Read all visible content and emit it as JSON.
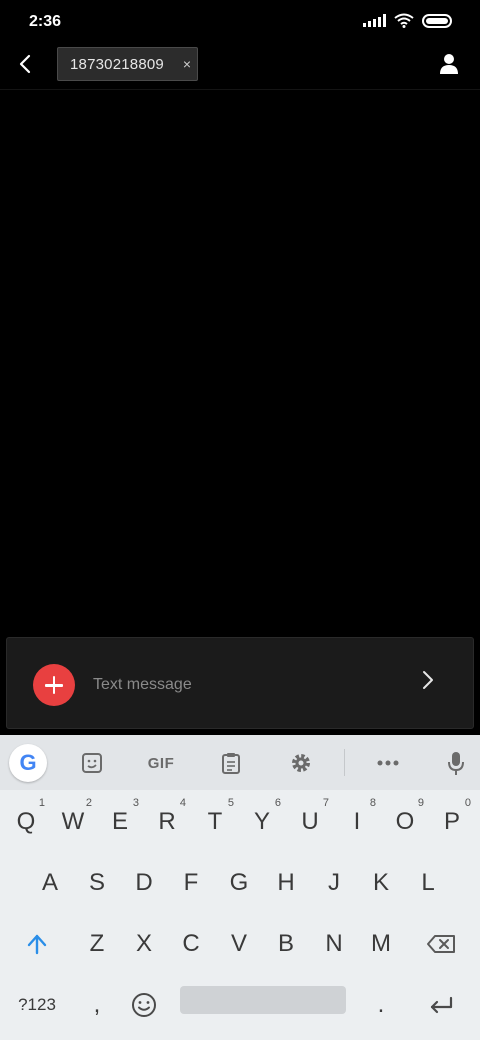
{
  "status_bar": {
    "time": "2:36",
    "icons": [
      "signal-icon",
      "wifi-icon",
      "battery-icon"
    ]
  },
  "top_bar": {
    "back_icon": "chevron-left-icon",
    "recipient": "18730218809",
    "chip_close": "×",
    "contact_icon": "person-icon"
  },
  "compose": {
    "attach_icon": "plus-icon",
    "placeholder": "Text message",
    "send_icon": "chevron-right-icon",
    "attach_color": "#e84040"
  },
  "keyboard": {
    "toolbar": {
      "google_label": "G",
      "sticker_icon": "sticker-icon",
      "gif_label": "GIF",
      "clipboard_icon": "clipboard-icon",
      "settings_icon": "gear-icon",
      "more_icon": "more-icon",
      "mic_icon": "mic-icon"
    },
    "row1": [
      {
        "key": "Q",
        "hint": "1"
      },
      {
        "key": "W",
        "hint": "2"
      },
      {
        "key": "E",
        "hint": "3"
      },
      {
        "key": "R",
        "hint": "4"
      },
      {
        "key": "T",
        "hint": "5"
      },
      {
        "key": "Y",
        "hint": "6"
      },
      {
        "key": "U",
        "hint": "7"
      },
      {
        "key": "I",
        "hint": "8"
      },
      {
        "key": "O",
        "hint": "9"
      },
      {
        "key": "P",
        "hint": "0"
      }
    ],
    "row2": [
      "A",
      "S",
      "D",
      "F",
      "G",
      "H",
      "J",
      "K",
      "L"
    ],
    "row3": [
      "Z",
      "X",
      "C",
      "V",
      "B",
      "N",
      "M"
    ],
    "row4": {
      "symbols": "?123",
      "comma": ",",
      "period": ".",
      "emoji_icon": "emoji-icon",
      "enter_icon": "enter-icon"
    },
    "shift_icon": "shift-icon",
    "backspace_icon": "backspace-icon",
    "shift_color": "#2a8ee8"
  }
}
